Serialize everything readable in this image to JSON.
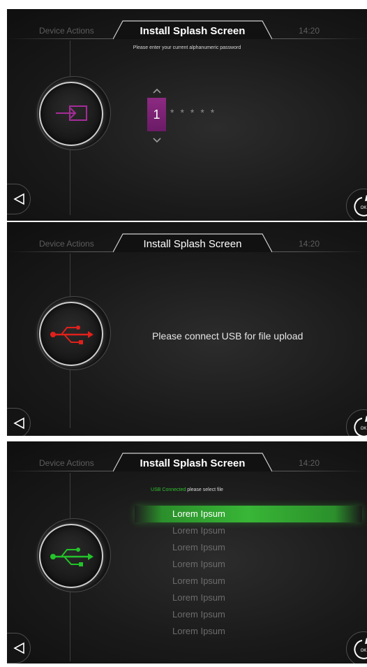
{
  "colors": {
    "accent_purple": "#8d2a82",
    "usb_red": "#e0201b",
    "usb_green": "#23c32a",
    "ok_green": "#38b636"
  },
  "panels": [
    {
      "header": {
        "left": "Device Actions",
        "title": "Install Splash Screen",
        "time": "14:20"
      },
      "subtitle": "Please enter your current alphanumeric password",
      "icon": "login-arrow-icon",
      "password": {
        "digit": "1",
        "masked": "*****"
      }
    },
    {
      "header": {
        "left": "Device Actions",
        "title": "Install Splash Screen",
        "time": "14:20"
      },
      "icon": "usb-icon",
      "message": "Please connect USB for file upload"
    },
    {
      "header": {
        "left": "Device Actions",
        "title": "Install Splash Screen",
        "time": "14:20"
      },
      "subtitle_status": "USB Connected",
      "subtitle_rest": " please select file",
      "icon": "usb-icon",
      "files": [
        "Lorem Ipsum",
        "Lorem Ipsum",
        "Lorem Ipsum",
        "Lorem Ipsum",
        "Lorem Ipsum",
        "Lorem Ipsum",
        "Lorem Ipsum",
        "Lorem Ipsum"
      ],
      "selected_index": 0
    }
  ],
  "buttons": {
    "ok_label": "OK"
  }
}
